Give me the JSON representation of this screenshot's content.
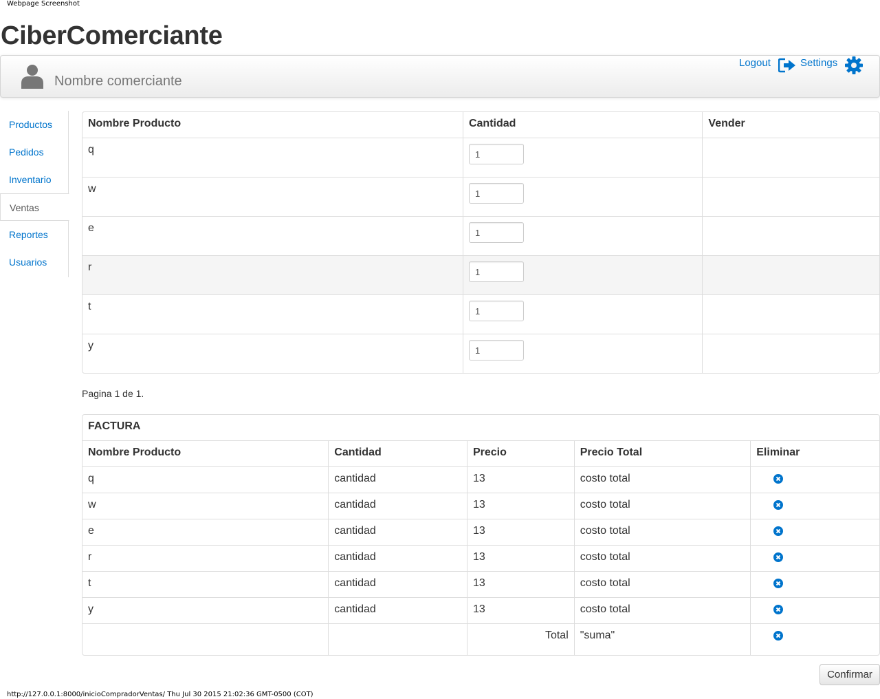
{
  "page": {
    "print_header": "Webpage Screenshot",
    "print_footer": "http://127.0.0.1:8000/inicioCompradorVentas/ Thu Jul 30 2015 21:02:36 GMT-0500 (COT)"
  },
  "brand": "CiberComerciante",
  "navbar": {
    "user_name": "Nombre comerciante",
    "logout_label": "Logout",
    "settings_label": "Settings",
    "accent_color": "#0074cc"
  },
  "sidebar": {
    "active": "Ventas",
    "items": [
      {
        "label": "Productos"
      },
      {
        "label": "Pedidos"
      },
      {
        "label": "Inventario"
      },
      {
        "label": "Ventas"
      },
      {
        "label": "Reportes"
      },
      {
        "label": "Usuarios"
      }
    ]
  },
  "products": {
    "headers": [
      "Nombre Producto",
      "Cantidad",
      "Vender"
    ],
    "rows": [
      {
        "name": "q",
        "qty": "1"
      },
      {
        "name": "w",
        "qty": "1"
      },
      {
        "name": "e",
        "qty": "1"
      },
      {
        "name": "r",
        "qty": "1"
      },
      {
        "name": "t",
        "qty": "1"
      },
      {
        "name": "y",
        "qty": "1"
      }
    ]
  },
  "pagination": "Pagina 1 de 1.",
  "invoice": {
    "caption": "FACTURA",
    "headers": [
      "Nombre Producto",
      "Cantidad",
      "Precio",
      "Precio Total",
      "Eliminar"
    ],
    "rows": [
      {
        "name": "q",
        "qty": "cantidad",
        "price": "13",
        "total": "costo total"
      },
      {
        "name": "w",
        "qty": "cantidad",
        "price": "13",
        "total": "costo total"
      },
      {
        "name": "e",
        "qty": "cantidad",
        "price": "13",
        "total": "costo total"
      },
      {
        "name": "r",
        "qty": "cantidad",
        "price": "13",
        "total": "costo total"
      },
      {
        "name": "t",
        "qty": "cantidad",
        "price": "13",
        "total": "costo total"
      },
      {
        "name": "y",
        "qty": "cantidad",
        "price": "13",
        "total": "costo total"
      }
    ],
    "total_label": "Total",
    "total_value": "\"suma\""
  },
  "confirm_label": "Confirmar"
}
